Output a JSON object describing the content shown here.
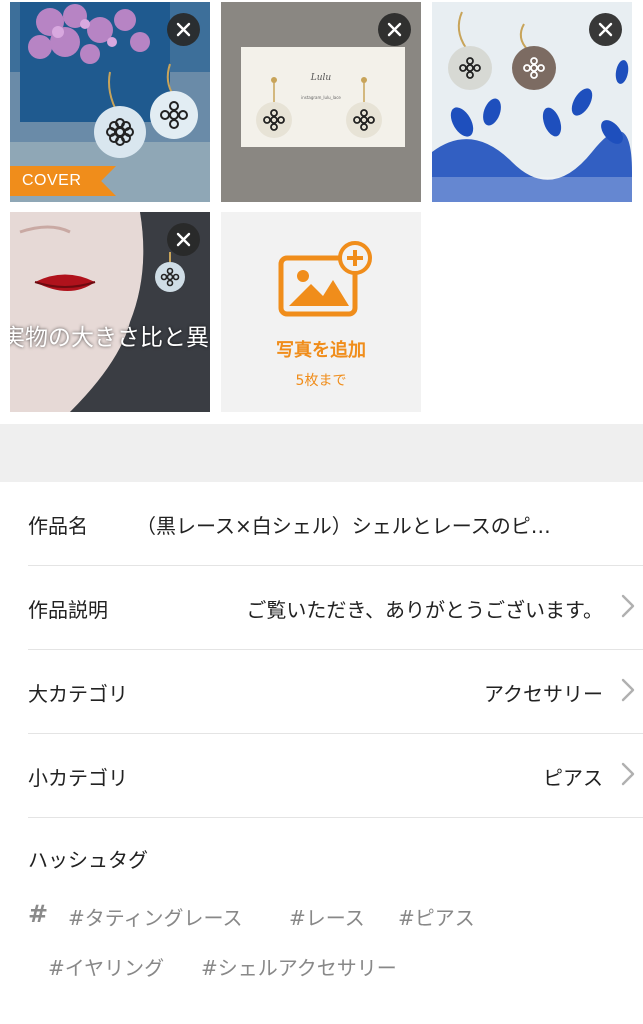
{
  "photos": {
    "cover_label": "COVER",
    "overlay_text": "実物の大きさ比と異なりま",
    "card_brand": "Lulu",
    "card_subtext": "instagram_lulu_lace",
    "add_photo_label": "写真を追加",
    "add_photo_limit": "5枚まで",
    "accent_color": "#f08d1b"
  },
  "form": {
    "title": {
      "label": "作品名",
      "value": "（黒レース×白シェル）シェルとレースのピ…"
    },
    "description": {
      "label": "作品説明",
      "value": "ご覧いただき、ありがとうございます。"
    },
    "main_category": {
      "label": "大カテゴリ",
      "value": "アクセサリー"
    },
    "sub_category": {
      "label": "小カテゴリ",
      "value": "ピアス"
    }
  },
  "hashtags": {
    "title": "ハッシュタグ",
    "icon": "#",
    "tags": [
      "#タティングレース",
      "#レース",
      "#ピアス",
      "#イヤリング",
      "#シェルアクセサリー"
    ]
  }
}
